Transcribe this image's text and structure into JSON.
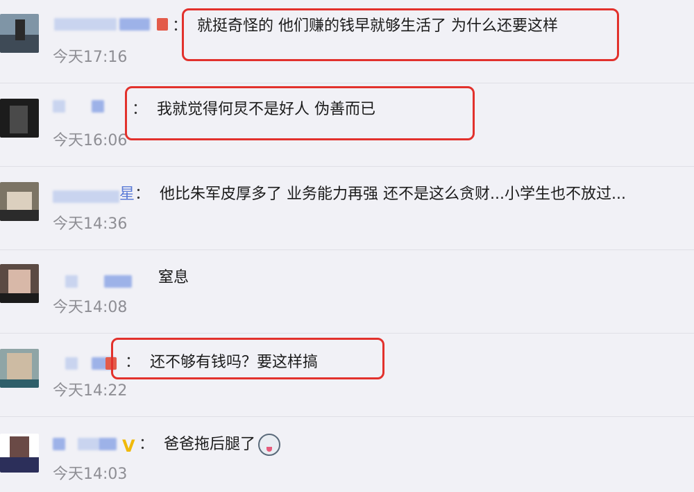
{
  "comments": [
    {
      "text": "就挺奇怪的 他们赚的钱早就够生活了 为什么还要这样",
      "time": "今天17:16"
    },
    {
      "text": "我就觉得何炅不是好人 伪善而已",
      "time": "今天16:06"
    },
    {
      "text": "他比朱军皮厚多了 业务能力再强 还不是这么贪财...小学生也不放过...",
      "time": "今天14:36",
      "name_tail": "星"
    },
    {
      "text": "窒息",
      "time": "今天14:08"
    },
    {
      "text": "还不够有钱吗？要这样搞",
      "time": "今天14:22"
    },
    {
      "text": "爸爸拖后腿了",
      "time": "今天14:03",
      "badge": "V",
      "emoji_icon": "surprised-face-icon"
    }
  ],
  "separator": "：",
  "colors": {
    "background": "#f1f1f6",
    "highlight": "#e2312c",
    "time": "#8e8e94",
    "name_blur": "#c9d4ef",
    "verified_badge": "#f0b90a"
  }
}
